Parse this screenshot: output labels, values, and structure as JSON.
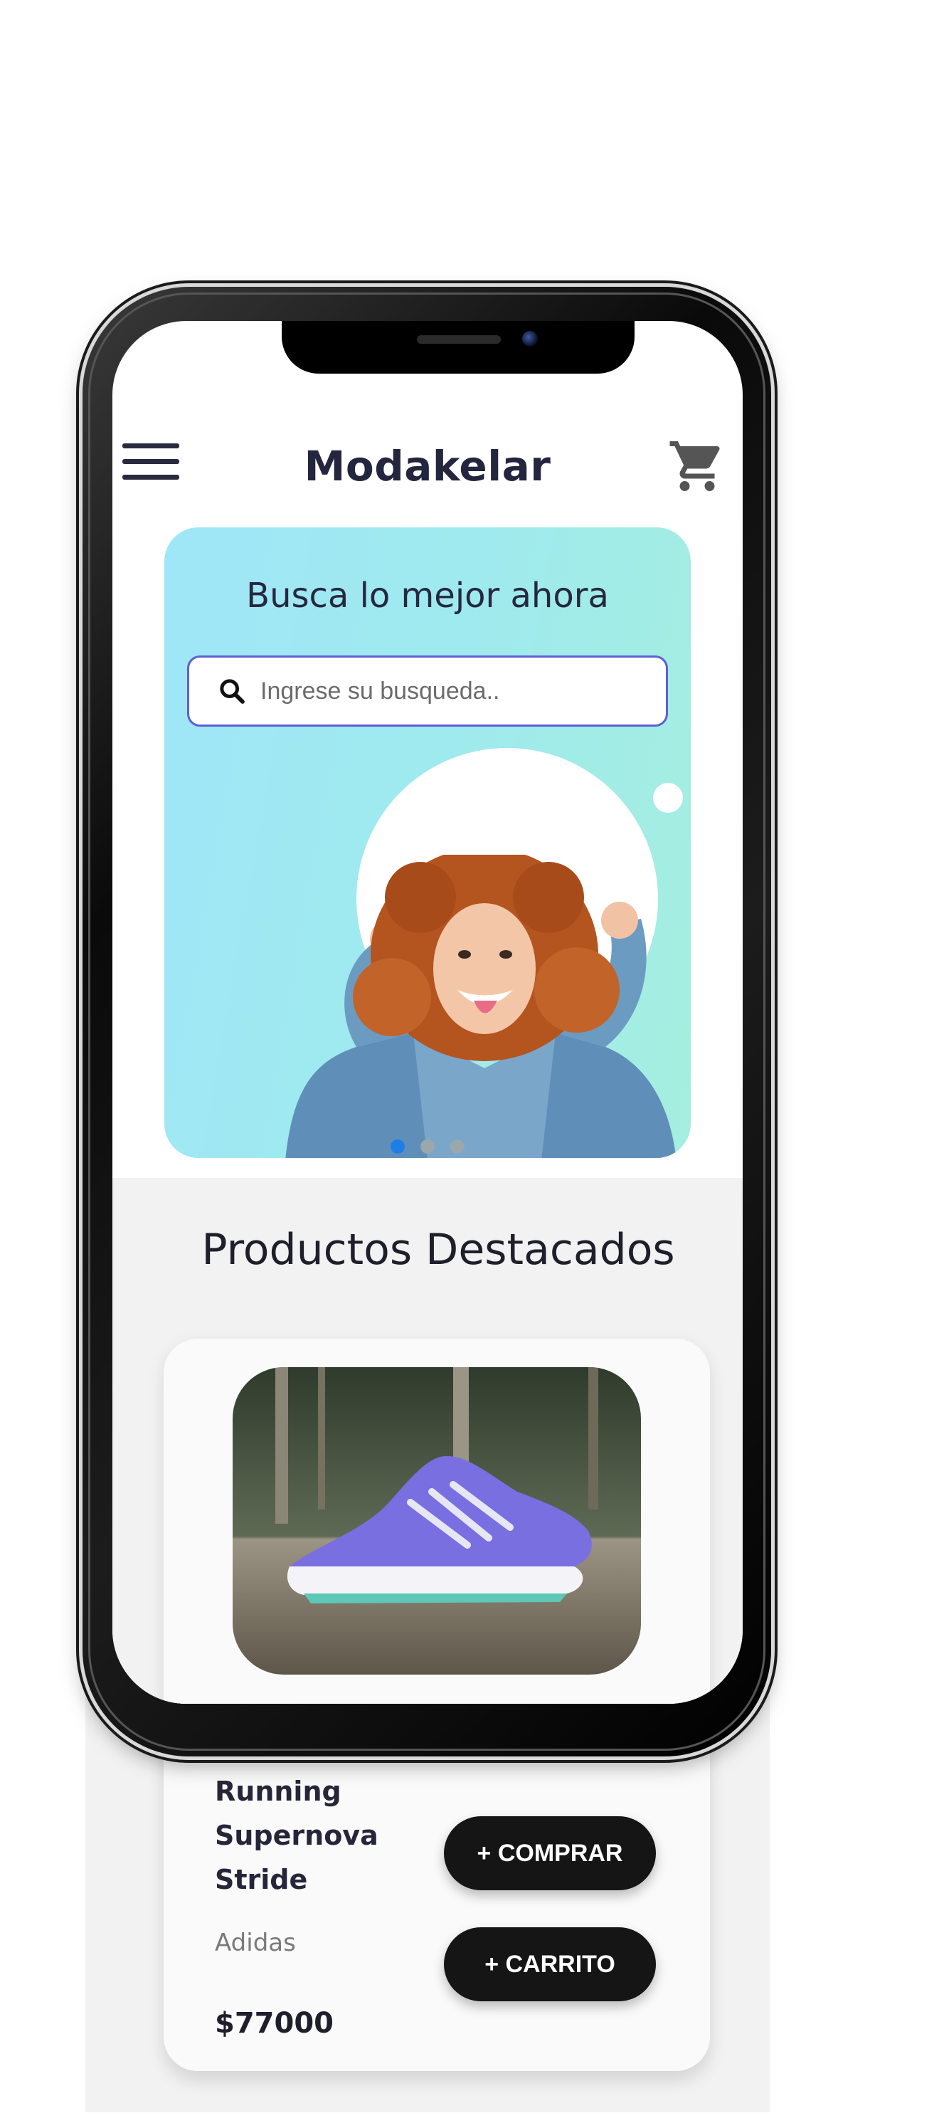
{
  "header": {
    "brand": "Modakelar"
  },
  "hero": {
    "title": "Busca lo mejor ahora",
    "search_placeholder": "Ingrese su busqueda..",
    "carousel_active_index": 0,
    "carousel_count": 3
  },
  "featured": {
    "section_title": "Productos Destacados",
    "product": {
      "name": "Running Supernova Stride",
      "brand": "Adidas",
      "price": "$77000",
      "buy_label": "+ COMPRAR",
      "cart_label": "+ CARRITO"
    }
  },
  "icons": {
    "menu": "hamburger-menu-icon",
    "cart": "shopping-cart-icon",
    "search": "search-icon"
  },
  "colors": {
    "brand_text": "#24263f",
    "search_border": "#5c5fd6",
    "carousel_active": "#1e7ee8",
    "button_bg": "#151515"
  }
}
